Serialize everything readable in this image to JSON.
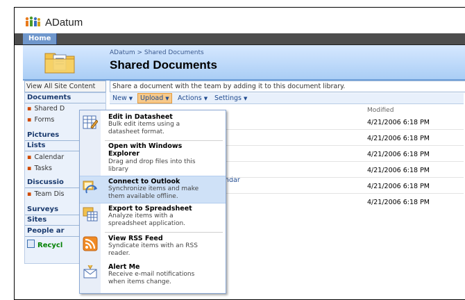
{
  "site": {
    "title": "ADatum"
  },
  "topnav": {
    "home_tab": "Home"
  },
  "header": {
    "breadcrumb": "ADatum > Shared Documents",
    "page_title": "Shared Documents"
  },
  "leftnav": {
    "view_all": "View All Site Content",
    "documents": "Documents",
    "doc_items": [
      "Shared D",
      "Forms"
    ],
    "pictures": "Pictures",
    "lists": "Lists",
    "list_items": [
      "Calendar",
      "Tasks"
    ],
    "discussions": "Discussio",
    "discussion_items": [
      "Team Dis"
    ],
    "surveys": "Surveys",
    "sites": "Sites",
    "people": "People ar",
    "recycle": "Recycl"
  },
  "main": {
    "description": "Share a document with the team by adding it to this document library.",
    "toolbar": {
      "new": "New",
      "upload": "Upload",
      "actions": "Actions",
      "settings": "Settings"
    },
    "column_modified": "Modified",
    "calendar_fragment": "ndar",
    "rows": [
      "4/21/2006 6:18 PM",
      "4/21/2006 6:18 PM",
      "4/21/2006 6:18 PM",
      "4/21/2006 6:18 PM",
      "4/21/2006 6:18 PM",
      "4/21/2006 6:18 PM"
    ]
  },
  "actions_menu": [
    {
      "title": "Edit in Datasheet",
      "desc": [
        "Bulk edit items using a",
        "datasheet format."
      ],
      "icon": "datasheet-icon"
    },
    {
      "title": "Open with Windows Explorer",
      "desc": [
        "Drag and drop files into this",
        "library"
      ],
      "icon": "explorer-folder-icon"
    },
    {
      "title": "Connect to Outlook",
      "desc": [
        "Synchronize items and make",
        "them available offline."
      ],
      "icon": "outlook-icon"
    },
    {
      "title": "Export to Spreadsheet",
      "desc": [
        "Analyze items with a",
        "spreadsheet application."
      ],
      "icon": "spreadsheet-icon"
    },
    {
      "title": "View RSS Feed",
      "desc": [
        "Syndicate items with an RSS",
        "reader."
      ],
      "icon": "rss-icon"
    },
    {
      "title": "Alert Me",
      "desc": [
        "Receive e-mail notifications",
        "when items change."
      ],
      "icon": "alert-envelope-icon"
    }
  ],
  "colors": {
    "accent": "#6f97cc",
    "nav_bg": "#eaf1fb",
    "highlight": "#cfe1f7",
    "upload_hover": "#f7c98a"
  }
}
